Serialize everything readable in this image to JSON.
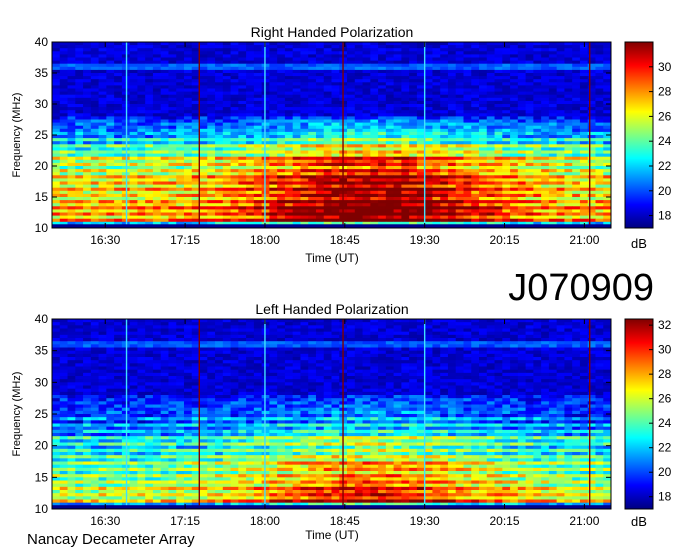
{
  "observation_id": "J070909",
  "footer": "Nancay Decameter Array",
  "colors": {
    "colormap": [
      "#00007f",
      "#0000ff",
      "#0080ff",
      "#00ffff",
      "#80ff80",
      "#ffff00",
      "#ff8000",
      "#ff0000",
      "#7f0000"
    ]
  },
  "chart_data": [
    {
      "type": "heatmap",
      "title": "Right Handed Polarization",
      "xlabel": "Time (UT)",
      "ylabel": "Frequency (MHz)",
      "x_ticks": [
        "16:30",
        "17:15",
        "18:00",
        "18:45",
        "19:30",
        "20:15",
        "21:00"
      ],
      "y_ticks": [
        10,
        15,
        20,
        25,
        30,
        35,
        40
      ],
      "ylim": [
        10,
        40
      ],
      "xlim_minutes_utc": [
        960,
        1275
      ],
      "x_tick_minutes": [
        990,
        1035,
        1080,
        1125,
        1170,
        1215,
        1260
      ],
      "colorbar": {
        "label": "dB",
        "min": 17,
        "max": 32,
        "ticks": [
          18,
          20,
          22,
          24,
          26,
          28,
          30
        ]
      },
      "emission_profile_db": [
        {
          "freq": 10.5,
          "db": 18
        },
        {
          "freq": 11,
          "db": 31
        },
        {
          "freq": 12,
          "db": 30
        },
        {
          "freq": 13,
          "db": 31
        },
        {
          "freq": 14,
          "db": 30
        },
        {
          "freq": 15,
          "db": 29
        },
        {
          "freq": 16,
          "db": 30
        },
        {
          "freq": 17,
          "db": 29
        },
        {
          "freq": 18,
          "db": 30
        },
        {
          "freq": 19,
          "db": 28
        },
        {
          "freq": 20,
          "db": 27
        },
        {
          "freq": 21,
          "db": 29
        },
        {
          "freq": 22,
          "db": 25
        },
        {
          "freq": 23,
          "db": 26
        },
        {
          "freq": 24,
          "db": 23
        },
        {
          "freq": 25,
          "db": 23
        },
        {
          "freq": 26,
          "db": 21
        },
        {
          "freq": 27,
          "db": 21
        },
        {
          "freq": 28,
          "db": 19
        },
        {
          "freq": 30,
          "db": 19
        },
        {
          "freq": 33,
          "db": 18
        },
        {
          "freq": 36,
          "db": 20
        },
        {
          "freq": 38,
          "db": 18
        },
        {
          "freq": 40,
          "db": 18
        }
      ],
      "vertical_artifacts_minutes": [
        1002,
        1043,
        1080,
        1124,
        1170,
        1263
      ]
    },
    {
      "type": "heatmap",
      "title": "Left Handed Polarization",
      "xlabel": "Time (UT)",
      "ylabel": "Frequency (MHz)",
      "x_ticks": [
        "16:30",
        "17:15",
        "18:00",
        "18:45",
        "19:30",
        "20:15",
        "21:00"
      ],
      "y_ticks": [
        10,
        15,
        20,
        25,
        30,
        35,
        40
      ],
      "ylim": [
        10,
        40
      ],
      "xlim_minutes_utc": [
        960,
        1275
      ],
      "x_tick_minutes": [
        990,
        1035,
        1080,
        1125,
        1170,
        1215,
        1260
      ],
      "colorbar": {
        "label": "dB",
        "min": 17,
        "max": 32.5,
        "ticks": [
          18,
          20,
          22,
          24,
          26,
          28,
          30,
          32
        ]
      },
      "emission_profile_db": [
        {
          "freq": 10.5,
          "db": 18
        },
        {
          "freq": 11,
          "db": 30
        },
        {
          "freq": 12,
          "db": 28
        },
        {
          "freq": 13,
          "db": 29
        },
        {
          "freq": 14,
          "db": 27
        },
        {
          "freq": 15,
          "db": 27
        },
        {
          "freq": 16,
          "db": 26
        },
        {
          "freq": 17,
          "db": 27
        },
        {
          "freq": 18,
          "db": 25
        },
        {
          "freq": 19,
          "db": 24
        },
        {
          "freq": 20,
          "db": 24
        },
        {
          "freq": 21,
          "db": 25
        },
        {
          "freq": 22,
          "db": 22
        },
        {
          "freq": 23,
          "db": 22
        },
        {
          "freq": 24,
          "db": 21
        },
        {
          "freq": 25,
          "db": 21
        },
        {
          "freq": 26,
          "db": 20
        },
        {
          "freq": 27,
          "db": 20
        },
        {
          "freq": 28,
          "db": 19
        },
        {
          "freq": 30,
          "db": 19
        },
        {
          "freq": 33,
          "db": 18
        },
        {
          "freq": 36,
          "db": 20
        },
        {
          "freq": 38,
          "db": 18
        },
        {
          "freq": 40,
          "db": 18
        }
      ],
      "vertical_artifacts_minutes": [
        1002,
        1043,
        1080,
        1124,
        1170,
        1263
      ]
    }
  ]
}
